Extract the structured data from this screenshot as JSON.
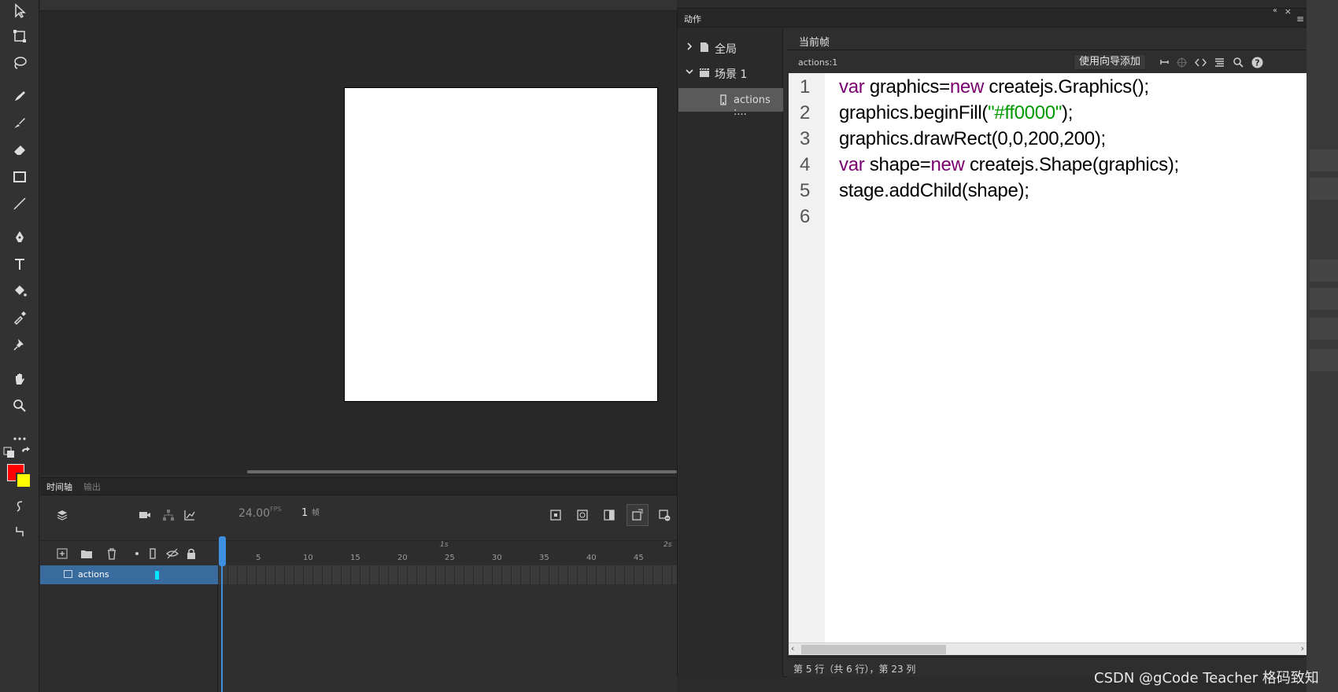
{
  "timeline": {
    "tab_timeline": "时间轴",
    "tab_output": "输出",
    "fps": "24.00",
    "fps_unit": "FPS",
    "frame": "1",
    "frame_unit": "帧",
    "layer_name": "actions",
    "ruler_ticks": [
      "5",
      "10",
      "15",
      "20",
      "25",
      "30",
      "35",
      "40",
      "45"
    ],
    "seconds": [
      "1s",
      "2s"
    ]
  },
  "actions_panel": {
    "title": "动作",
    "nav": {
      "global": "全局",
      "scene": "场景 1",
      "actions": "actions :..."
    },
    "frame_tab": "当前帧",
    "path": "actions:1",
    "wizard_button": "使用向导添加",
    "code_lines": [
      "var graphics=new createjs.Graphics();",
      "graphics.beginFill(\"#ff0000\");",
      "graphics.drawRect(0,0,200,200);",
      "var shape=new createjs.Shape(graphics);",
      "stage.addChild(shape);",
      ""
    ],
    "line_numbers": [
      "1",
      "2",
      "3",
      "4",
      "5",
      "6"
    ],
    "status": "第 5 行（共 6 行），第 23 列"
  },
  "colors": {
    "stroke": "#ff0000",
    "fill": "#ffff00",
    "keyword": "#7a006f",
    "string": "#009900",
    "layer_highlight": "#3a6b9e",
    "playhead": "#3d8fe0"
  },
  "watermark": "CSDN @gCode Teacher 格码致知"
}
